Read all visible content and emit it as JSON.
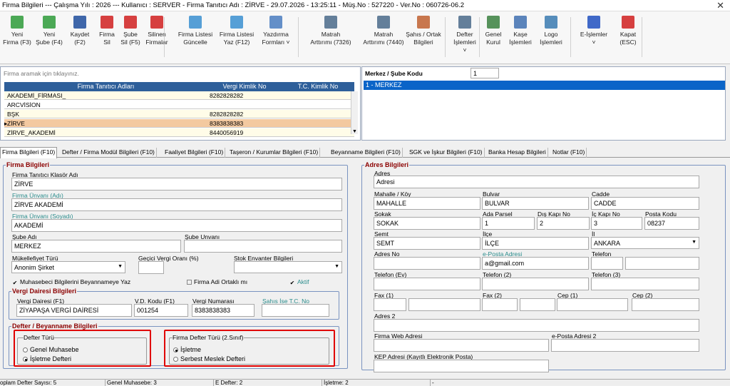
{
  "titlebar": {
    "text": "Firma Bilgileri  ---  Çalışma Yılı : 2026  ---  Kullanıcı : SERVER - Firma Tanıtıcı Adı : ZİRVE - 29.07.2026 - 13:25:11 - Müş.No : 527220 - Ver.No : 060726-06.2",
    "close": "✕"
  },
  "toolbar": [
    {
      "l1": "Yeni",
      "l2": "Firma (F3)",
      "icon": "new-firm-icon",
      "color": "#2e9b3a"
    },
    {
      "l1": "Yeni",
      "l2": "Şube (F4)",
      "icon": "new-branch-icon",
      "color": "#2e9b3a"
    },
    {
      "l1": "Kaydet",
      "l2": "(F2)",
      "icon": "save-icon",
      "color": "#1f4e9c"
    },
    {
      "l1": "Firma",
      "l2": "Sil",
      "icon": "delete-firm-icon",
      "color": "#d02020"
    },
    {
      "l1": "Şube",
      "l2": "Sil (F5)",
      "icon": "delete-branch-icon",
      "color": "#d02020"
    },
    {
      "l1": "Silinen",
      "l2": "Firmalar",
      "icon": "deleted-firms-icon",
      "color": "#d02020"
    },
    {
      "l1": "Firma Listesi",
      "l2": "Güncelle",
      "icon": "refresh-list-icon",
      "color": "#3a8fd0"
    },
    {
      "l1": "Firma Listesi",
      "l2": "Yaz (F12)",
      "icon": "print-list-icon",
      "color": "#3a8fd0"
    },
    {
      "l1": "Yazdırma",
      "l2": "Formları ˅",
      "icon": "print-forms-icon",
      "color": "#4a7cc0"
    },
    {
      "l1": "Matrah",
      "l2": "Arttırımı (7326)",
      "icon": "tax-base-7326-icon",
      "color": "#4a6a8a"
    },
    {
      "l1": "Matrah",
      "l2": "Arttırımı (7440)",
      "icon": "tax-base-7440-icon",
      "color": "#4a6a8a"
    },
    {
      "l1": "Şahıs / Ortak",
      "l2": "Bilgileri",
      "icon": "partners-icon",
      "color": "#c06030"
    },
    {
      "l1": "Defter",
      "l2": "İşlemleri ˅",
      "icon": "ledger-icon",
      "color": "#4a6a8a"
    },
    {
      "l1": "Genel",
      "l2": "Kurul",
      "icon": "general-assembly-icon",
      "color": "#3a8040"
    },
    {
      "l1": "Kaşe",
      "l2": "İşlemleri",
      "icon": "stamp-icon",
      "color": "#4070b0"
    },
    {
      "l1": "Logo",
      "l2": "İşlemleri",
      "icon": "logo-icon",
      "color": "#3a7ab0"
    },
    {
      "l1": "E-İşlemler",
      "l2": "˅",
      "icon": "e-operations-icon",
      "color": "#2050c0"
    },
    {
      "l1": "Kapat",
      "l2": "(ESC)",
      "icon": "close-app-icon",
      "color": "#d02020"
    }
  ],
  "search": {
    "placeholder": "Firma aramak için tıklayınız."
  },
  "grid": {
    "headers": [
      "Firma Tanıtıcı Adları",
      "Vergi Kimlik No",
      "T.C. Kimlik No"
    ],
    "rows": [
      {
        "name": "AKADEMİ_FİRMASI_",
        "vkn": "8282828282",
        "tc": ""
      },
      {
        "name": "ARCVİSİON",
        "vkn": "",
        "tc": ""
      },
      {
        "name": "BŞK",
        "vkn": "8282828282",
        "tc": ""
      },
      {
        "name": "ZİRVE",
        "vkn": "8383838383",
        "tc": "",
        "selected": true
      },
      {
        "name": "ZİRVE_AKADEMİ",
        "vkn": "8440056919",
        "tc": ""
      }
    ]
  },
  "branch": {
    "label": "Merkez / Şube Kodu",
    "code": "1",
    "items": [
      "1 - MERKEZ"
    ]
  },
  "tabs": [
    "Firma Bilgileri (F10)",
    "Defter / Firma Modül Bilgileri (F10)",
    "Faaliyet Bilgileri (F10)",
    "Taşeron / Kurumlar Bilgileri (F10)",
    "Beyanname Bilgileri (F10)",
    "SGK ve İşkur Bilgileri (F10)",
    "Banka Hesap Bilgileri",
    "Notlar (F10)"
  ],
  "firma": {
    "section": "Firma Bilgileri",
    "klasor_label": "Firma Tanıtıcı Klasör Adı",
    "klasor": "ZİRVE",
    "unvan_adi_label": "Firma Ünvanı (Adı)",
    "unvan_adi": "ZİRVE AKADEMİ",
    "unvan_soyadi_label": "Firma Ünvanı (Soyadı)",
    "unvan_soyadi": "AKADEMİ",
    "sube_adi_label": "Şube Adı",
    "sube_adi": "MERKEZ",
    "sube_unvani_label": "Şube Unvanı",
    "sube_unvani": "",
    "mukellefiyet_label": "Mükellefiyet Türü",
    "mukellefiyet": "Anonim Şirket",
    "gecici_label": "Geçici Vergi Oranı (%)",
    "gecici": "",
    "stok_label": "Stok Envanter Bilgileri",
    "stok": "",
    "muhasebeci_chk": "Muhasebeci Bilgilerini Beyannameye Yaz",
    "ortakli_chk": "Firma Adi Ortaklı mı",
    "aktif_chk": "Aktif"
  },
  "vergi": {
    "section": "Vergi Dairesi Bilgileri",
    "daire_label": "Vergi Dairesi (F1)",
    "daire": "ZİYAPAŞA VERGİ DAİRESİ",
    "kod_label": "V.D. Kodu (F1)",
    "kod": "001254",
    "no_label": "Vergi Numarası",
    "no": "8383838383",
    "tc_label": "Şahıs İse T.C. No",
    "tc": ""
  },
  "defter": {
    "section": "Defter / Beyanname Bilgileri",
    "tur_label": "Defter Türü",
    "genel": "Genel Muhasebe",
    "isletme": "İşletme Defteri",
    "tur2_label": "Firma Defter Türü (2.Sınıf)",
    "isletme2": "İşletme",
    "serbest": "Serbest Meslek Defteri"
  },
  "adres": {
    "section": "Adres Bilgileri",
    "adres_label": "Adres",
    "adres": "Adresi",
    "mahalle_label": "Mahalle / Köy",
    "mahalle": "MAHALLE",
    "bulvar_label": "Bulvar",
    "bulvar": "BULVAR",
    "cadde_label": "Cadde",
    "cadde": "CADDE",
    "sokak_label": "Sokak",
    "sokak": "SOKAK",
    "ada_label": "Ada Parsel",
    "ada": "1",
    "dis_label": "Dış Kapı No",
    "dis": "2",
    "ic_label": "İç Kapı No",
    "ic": "3",
    "posta_label": "Posta Kodu",
    "posta": "08237",
    "semt_label": "Semt",
    "semt": "SEMT",
    "ilce_label": "İlçe",
    "ilce": "İLÇE",
    "il_label": "İl",
    "il": "ANKARA",
    "adresno_label": "Adres No",
    "adresno": "",
    "eposta_label": "e-Posta Adresi",
    "eposta": "a@gmail.com",
    "telefon_label": "Telefon",
    "telev_label": "Telefon (Ev)",
    "tel2_label": "Telefon (2)",
    "tel3_label": "Telefon (3)",
    "fax1_label": "Fax (1)",
    "fax2_label": "Fax (2)",
    "cep1_label": "Cep (1)",
    "cep2_label": "Cep (2)",
    "adres2_label": "Adres 2",
    "web_label": "Firma Web Adresi",
    "eposta2_label": "e-Posta Adresi 2",
    "kep_label": "KEP Adresi (Kayıtlı Elektronik Posta)"
  },
  "status": {
    "toplam": "oplam Defter Sayısı: 5",
    "genel": "Genel Muhasebe: 3",
    "edefter": "E Defter: 2",
    "isletme": "İşletme: 2",
    "dash": "-"
  }
}
